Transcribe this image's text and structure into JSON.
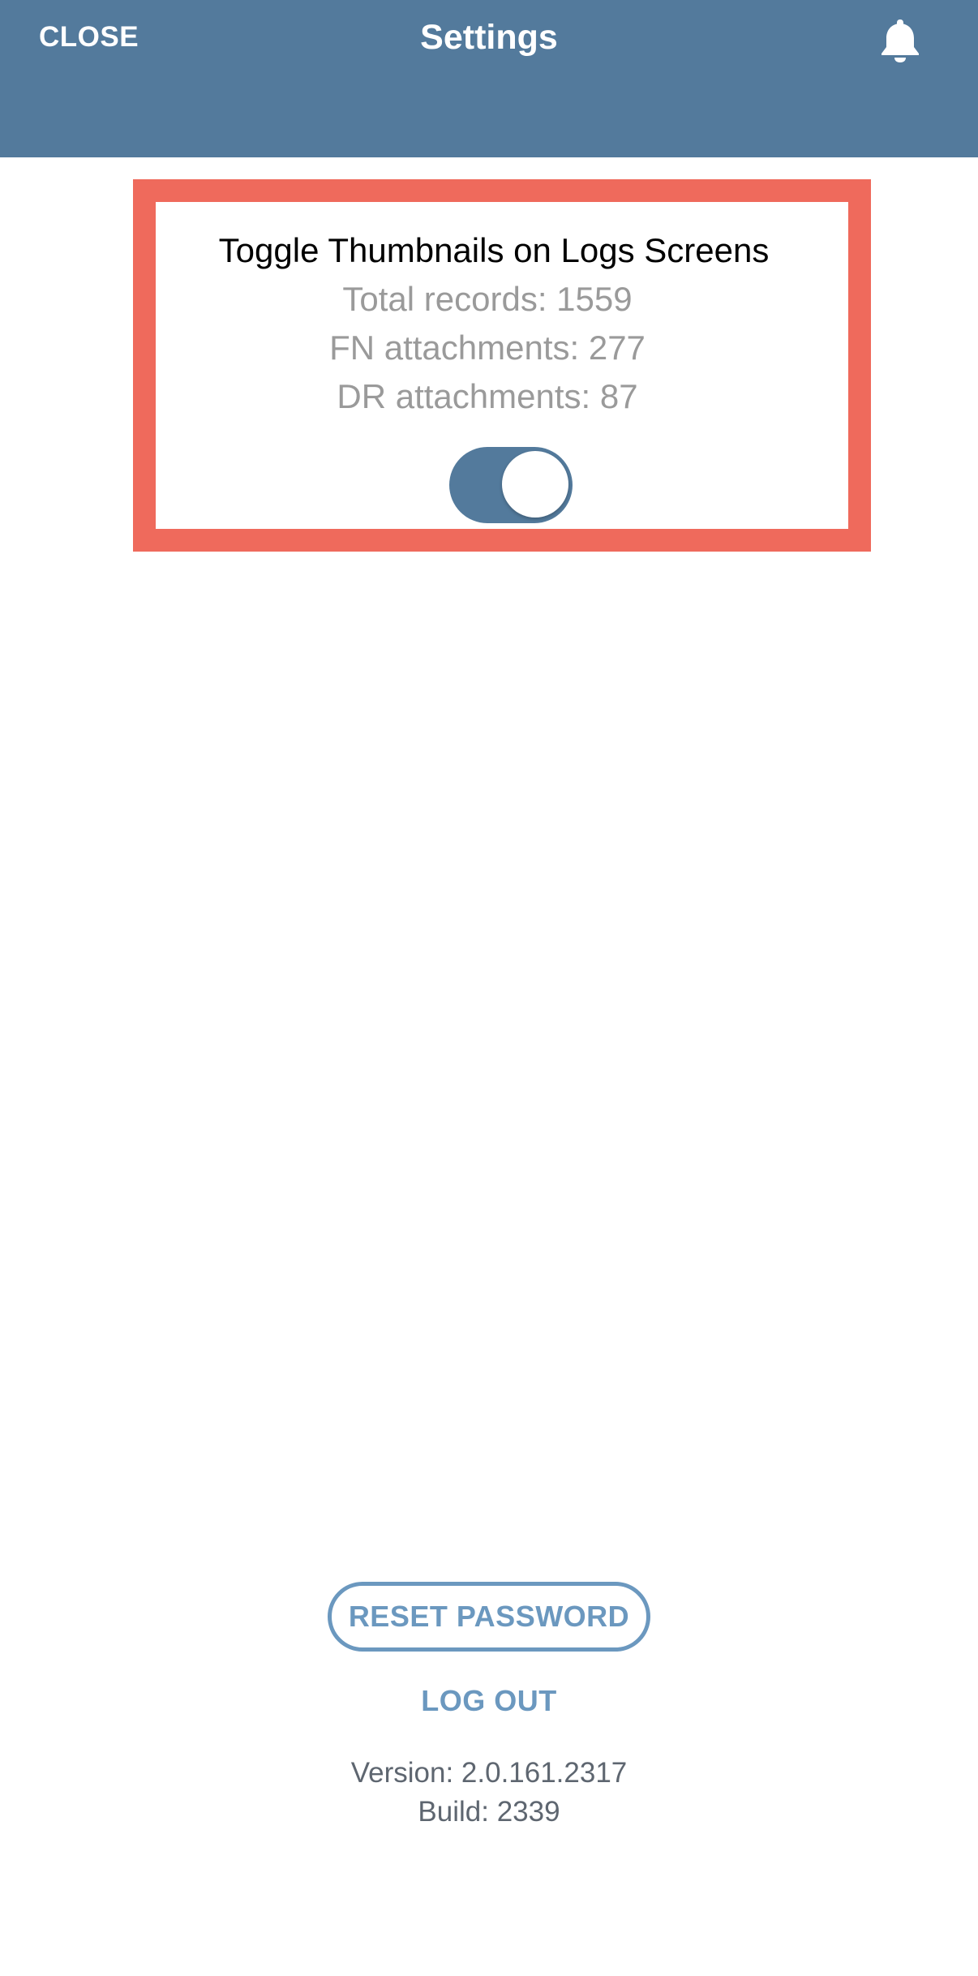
{
  "header": {
    "close_label": "CLOSE",
    "title": "Settings",
    "bell_icon": "bell-icon",
    "background_color": "#537a9c"
  },
  "thumbnail_card": {
    "title": "Toggle Thumbnails on Logs Screens",
    "total_records": "Total records: 1559",
    "fn_attachments": "FN attachments: 277",
    "dr_attachments": "DR attachments: 87",
    "toggle_on": true,
    "highlight_color": "#ef6a5c"
  },
  "actions": {
    "reset_password_label": "RESET PASSWORD",
    "logout_label": "LOG OUT",
    "accent_color": "#6b98bf"
  },
  "footer": {
    "version": "Version: 2.0.161.2317",
    "build": "Build: 2339"
  }
}
